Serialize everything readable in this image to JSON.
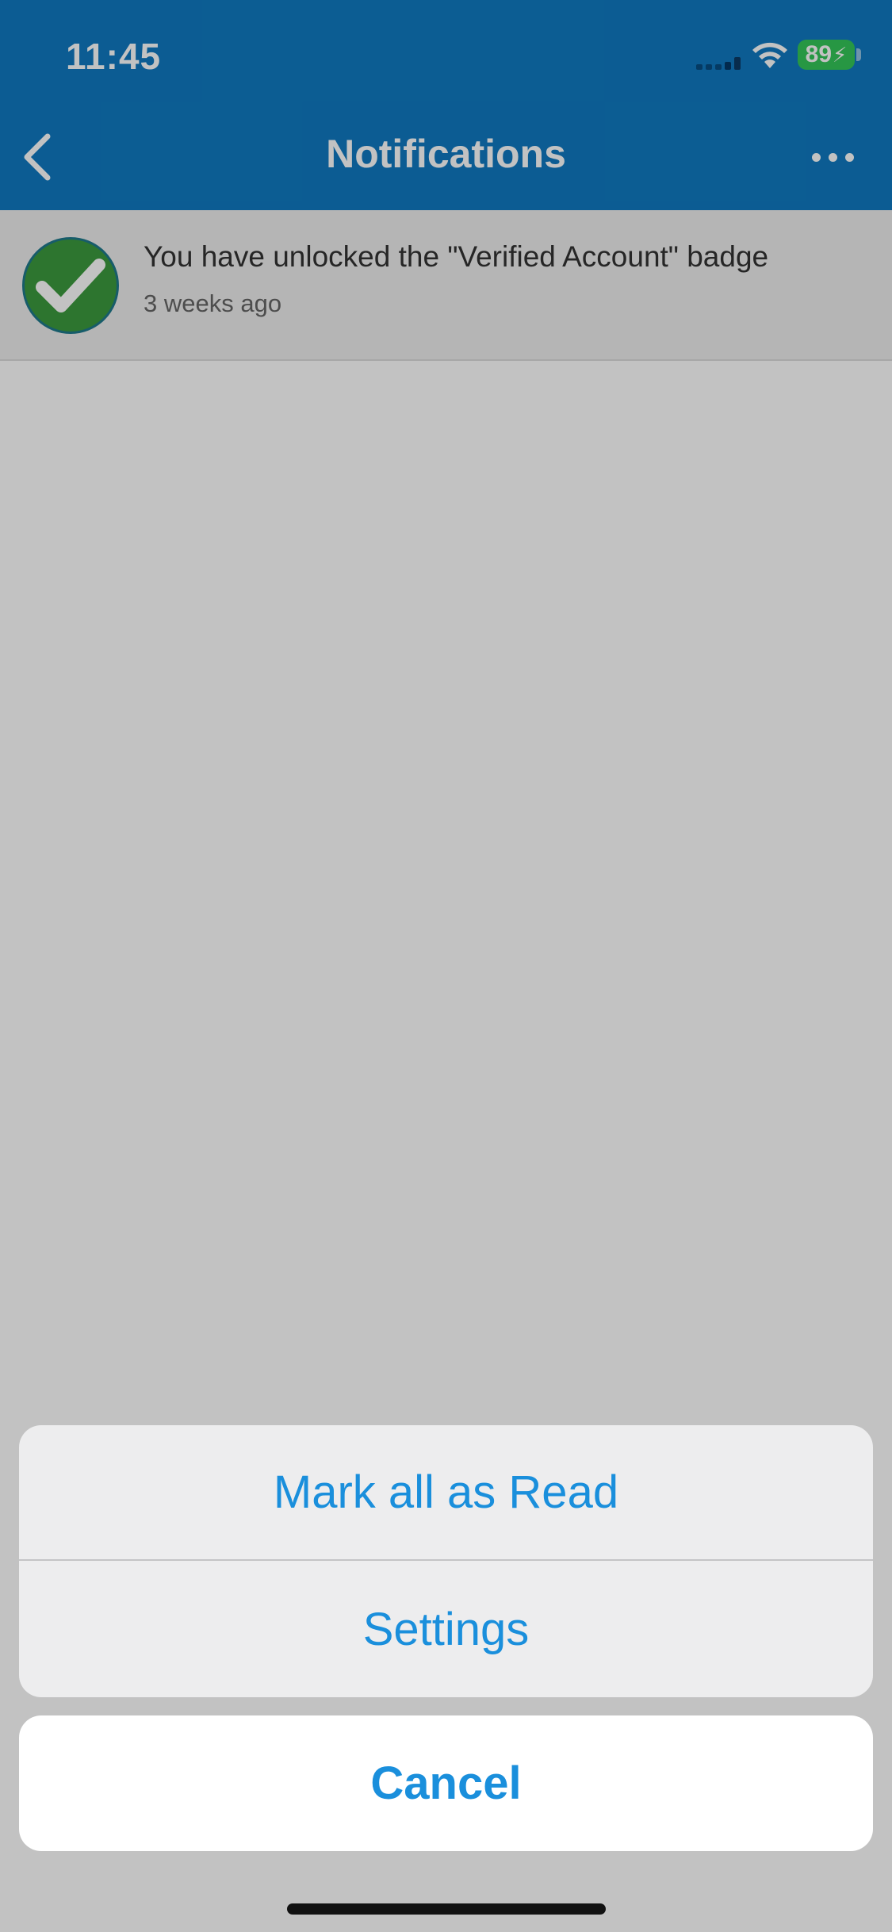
{
  "status_bar": {
    "time": "11:45",
    "battery_level": "89",
    "icons": [
      "signal-icon",
      "wifi-icon",
      "battery-icon",
      "charging-bolt-icon"
    ]
  },
  "nav": {
    "title": "Notifications",
    "back_icon": "chevron-left-icon",
    "more_icon": "more-dots-icon"
  },
  "notifications": [
    {
      "icon": "checkmark-badge-icon",
      "text": "You have unlocked the \"Verified Account\" badge",
      "time": "3 weeks ago"
    }
  ],
  "action_sheet": {
    "items": [
      {
        "label": "Mark all as Read"
      },
      {
        "label": "Settings"
      }
    ],
    "cancel_label": "Cancel"
  },
  "colors": {
    "header_bg": "#107ac1",
    "action_text": "#1a8fdc",
    "badge_green": "#3c9a3e",
    "battery_green": "#34c759"
  }
}
